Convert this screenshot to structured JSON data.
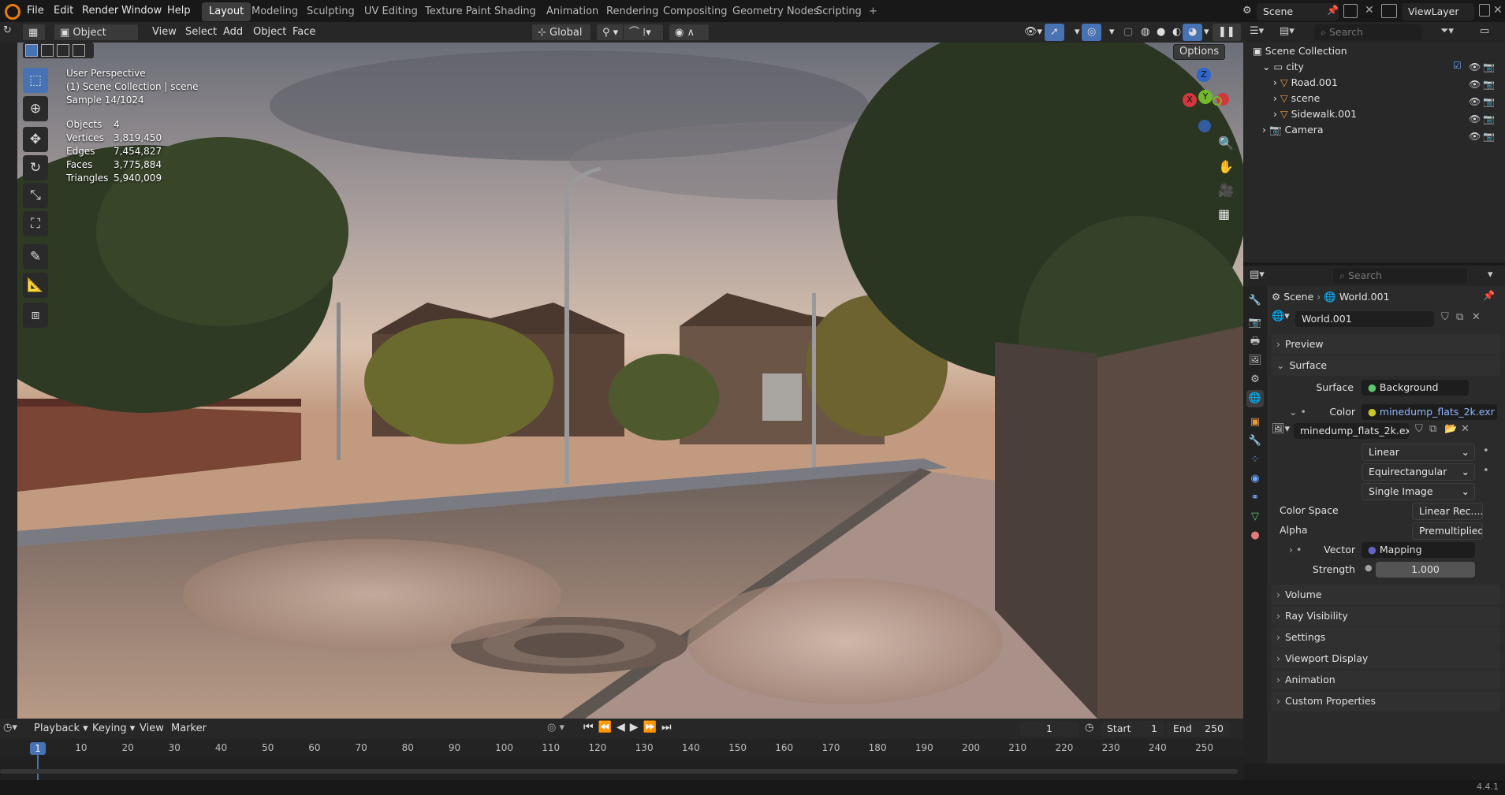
{
  "menu": {
    "items": [
      "File",
      "Edit",
      "Render",
      "Window",
      "Help"
    ]
  },
  "workspaces": {
    "tabs": [
      "Layout",
      "Modeling",
      "Sculpting",
      "UV Editing",
      "Texture Paint",
      "Shading",
      "Animation",
      "Rendering",
      "Compositing",
      "Geometry Nodes",
      "Scripting"
    ],
    "active": "Layout",
    "add": "+"
  },
  "top_right": {
    "scene": "Scene",
    "view_layer": "ViewLayer"
  },
  "viewport_header": {
    "mode": "Object Mode",
    "menus": [
      "View",
      "Select",
      "Add",
      "Object",
      "Face"
    ],
    "orientation": "Global",
    "options": "Options"
  },
  "viewport_overlay": {
    "perspective": "User Perspective",
    "collection": "(1) Scene Collection | scene",
    "sample": "Sample 14/1024",
    "stats": [
      {
        "label": "Objects",
        "value": "4"
      },
      {
        "label": "Vertices",
        "value": "3,819,450"
      },
      {
        "label": "Edges",
        "value": "7,454,827"
      },
      {
        "label": "Faces",
        "value": "3,775,884"
      },
      {
        "label": "Triangles",
        "value": "5,940,009"
      }
    ]
  },
  "gizmo": {
    "x": "X",
    "y": "Y",
    "z": "Z"
  },
  "outliner": {
    "search_placeholder": "Search",
    "root": "Scene Collection",
    "items": [
      {
        "name": "city",
        "level": 1
      },
      {
        "name": "Road.001",
        "level": 2
      },
      {
        "name": "scene",
        "level": 2
      },
      {
        "name": "Sidewalk.001",
        "level": 2
      },
      {
        "name": "Camera",
        "level": 1
      }
    ]
  },
  "properties": {
    "search_placeholder": "Search",
    "breadcrumb": [
      "Scene",
      "World.001"
    ],
    "world_name": "World.001",
    "panels": {
      "preview": "Preview",
      "surface": "Surface"
    },
    "surface_label": "Surface",
    "surface_value": "Background",
    "color_label": "Color",
    "color_value": "minedump_flats_2k.exr",
    "image_name": "minedump_flats_2k.exr",
    "interpolation": "Linear",
    "projection": "Equirectangular",
    "source": "Single Image",
    "color_space_label": "Color Space",
    "color_space_value": "Linear Rec....",
    "alpha_label": "Alpha",
    "alpha_value": "Premultiplied",
    "vector_label": "Vector",
    "vector_value": "Mapping",
    "strength_label": "Strength",
    "strength_value": "1.000",
    "collapsed": [
      "Volume",
      "Ray Visibility",
      "Settings",
      "Viewport Display",
      "Animation",
      "Custom Properties"
    ]
  },
  "timeline": {
    "menus": [
      "Playback",
      "Keying",
      "View",
      "Marker"
    ],
    "current_frame": "1",
    "start_label": "Start",
    "start_value": "1",
    "end_label": "End",
    "end_value": "250",
    "playhead": "1",
    "ticks": [
      "10",
      "20",
      "30",
      "40",
      "50",
      "60",
      "70",
      "80",
      "90",
      "100",
      "110",
      "120",
      "130",
      "140",
      "150",
      "160",
      "170",
      "180",
      "190",
      "200",
      "210",
      "220",
      "230",
      "240",
      "250"
    ]
  },
  "status": {
    "version": "4.4.1"
  },
  "colors": {
    "accent": "#4772b3",
    "selected_tab": "#3d3d3d",
    "playhead": "#4772b3",
    "yellow_socket": "#c7c729",
    "blue_socket": "#6363c7",
    "gray_socket": "#a1a1a1"
  }
}
